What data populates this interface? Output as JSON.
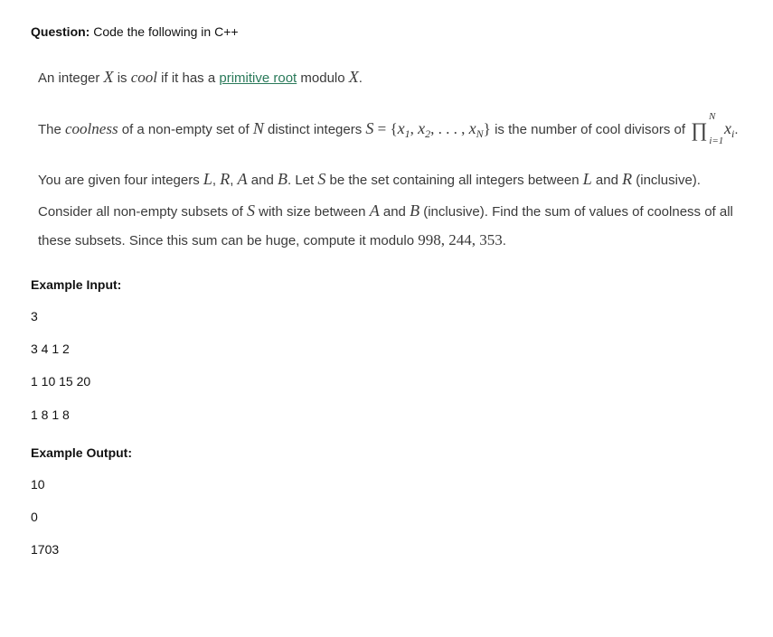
{
  "question_label": "Question:",
  "question_text": "Code the following in C++",
  "p1_a": "An integer ",
  "p1_b": " is ",
  "p1_cool": "cool",
  "p1_c": " if it has a ",
  "p1_link": "primitive root",
  "p1_d": " modulo ",
  "p1_e": ".",
  "p2_a": "The ",
  "p2_coolness": "coolness",
  "p2_b": " of a non-empty set of ",
  "p2_c": " distinct integers ",
  "p2_setexpr_a": " = {",
  "p2_setexpr_b": ", ",
  "p2_setexpr_c": ", . . . , ",
  "p2_setexpr_d": "} ",
  "p2_d": "is the number of cool divisors of ",
  "p2_prod_top": "N",
  "p2_prod_bot": "i=1",
  "p2_e": ".",
  "p3_a": "You are given four integers ",
  "p3_b": ", ",
  "p3_c": ", ",
  "p3_d": " and ",
  "p3_e": ". Let ",
  "p3_f": " be the set containing all integers between ",
  "p3_g": " and ",
  "p3_h": " (inclusive). Consider all non-empty subsets of ",
  "p3_i": " with size between ",
  "p3_j": " and ",
  "p3_k": " (inclusive). Find the sum of values of coolness of all these subsets. Since this sum can be huge, compute it modulo ",
  "p3_mod": "998, 244, 353",
  "p3_l": ".",
  "sym": {
    "X": "X",
    "N": "N",
    "S": "S",
    "L": "L",
    "R": "R",
    "A": "A",
    "B": "B",
    "x": "x",
    "xi": "x",
    "sub1": "1",
    "sub2": "2",
    "subN": "N",
    "subi": "i"
  },
  "example_input_label": "Example Input:",
  "example_output_label": "Example Output:",
  "input_lines": [
    "3",
    "3 4 1 2",
    "1 10 15 20",
    "1 8 1 8"
  ],
  "output_lines": [
    "10",
    "0",
    "1703"
  ]
}
